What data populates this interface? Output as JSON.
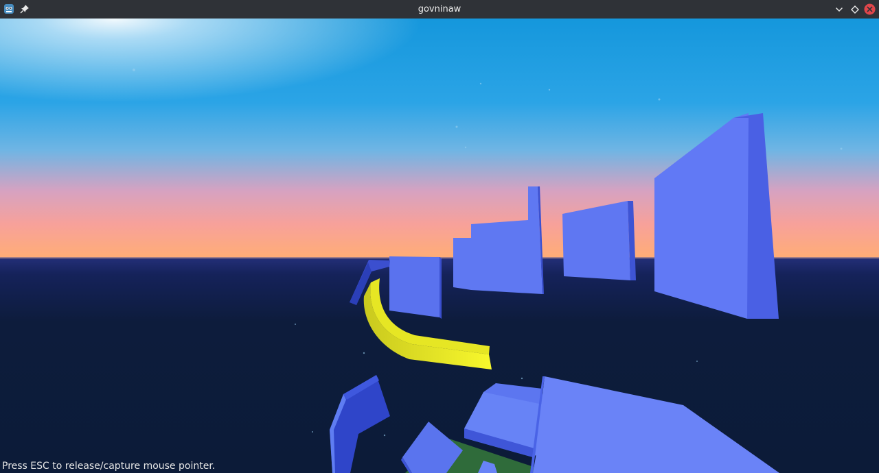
{
  "window": {
    "title": "govninaw",
    "app_icon": "godot-icon",
    "pin_icon": "pin-icon",
    "controls": [
      "minimize-chevron-icon",
      "maximize-diamond-icon",
      "close-icon"
    ],
    "close_color": "#e0464b"
  },
  "scene": {
    "sky_colors": {
      "zenith": "#13a0e2",
      "mid": "#43aee7",
      "horizon_pink": "#f39b9b",
      "horizon_orange": "#ffab77"
    },
    "ground_color": "#0d1c3c",
    "block_color": "#5f78f2",
    "block_shade_color": "#3f55d6",
    "path_color": "#f5f52a",
    "platform_color": "#2f6b3a"
  },
  "hud": {
    "hint": "Press ESC to release/capture mouse pointer."
  }
}
